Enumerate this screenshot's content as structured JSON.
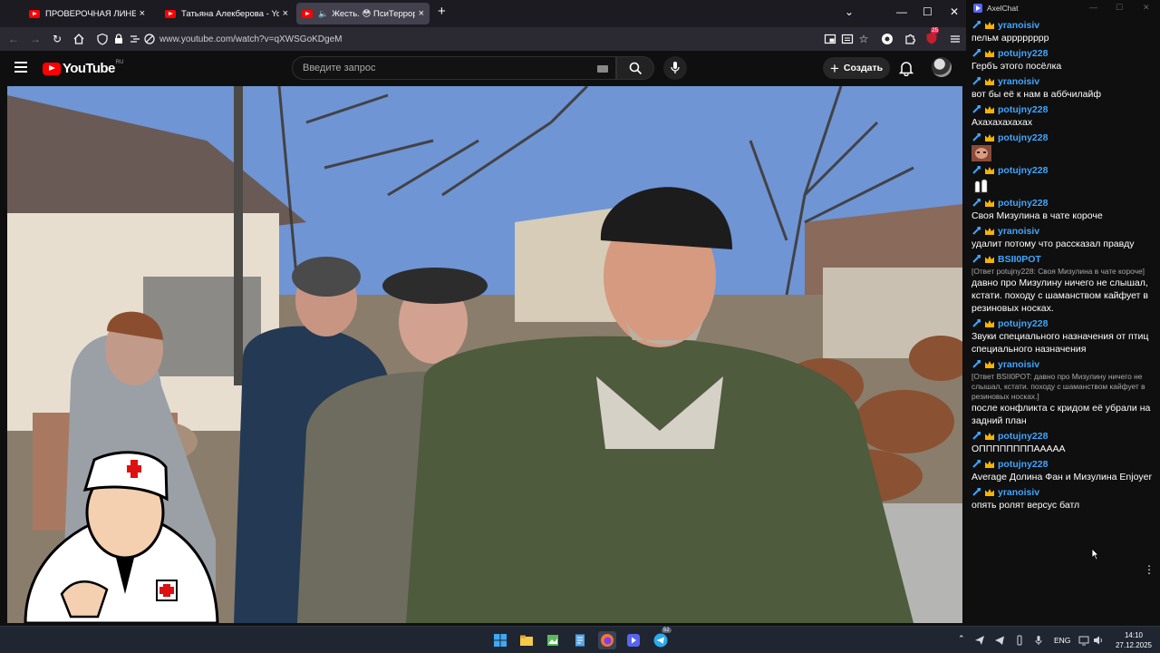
{
  "browser": {
    "tabs": [
      {
        "title": "ПРОВЕРОЧНАЯ ЛИНЕЙКА - M",
        "active": false,
        "playing": false
      },
      {
        "title": "Татьяна Алекберова - YouTube",
        "active": false,
        "playing": false
      },
      {
        "title": "Жесть. 😳 ПсиТеррор Сев",
        "active": true,
        "playing": true
      }
    ],
    "tab_close": "×",
    "new_tab": "+",
    "url": "www.youtube.com/watch?v=qXWSGoKDgeM",
    "extension_badge": "25",
    "window_controls": [
      "—",
      "☐",
      "✕"
    ],
    "tab_list": "⌄"
  },
  "youtube": {
    "logo_text": "YouTube",
    "logo_region": "RU",
    "search_placeholder": "Введите запрос",
    "create_label": "Создать",
    "create_plus": "+"
  },
  "chat": {
    "app_title": "AxelChat",
    "messages": [
      {
        "author": "yranoisiv",
        "reply": "",
        "text": "пельм арррррррр",
        "emote": ""
      },
      {
        "author": "potujny228",
        "reply": "",
        "text": "Гербъ этого посёлка",
        "emote": ""
      },
      {
        "author": "yranoisiv",
        "reply": "",
        "text": "вот бы её к нам в аббчилайф",
        "emote": ""
      },
      {
        "author": "potujny228",
        "reply": "",
        "text": "Ахахахахахах",
        "emote": ""
      },
      {
        "author": "potujny228",
        "reply": "",
        "text": "",
        "emote": "face-emote"
      },
      {
        "author": "potujny228",
        "reply": "",
        "text": "",
        "emote": "hands-emote"
      },
      {
        "author": "potujny228",
        "reply": "",
        "text": "Своя Мизулина в чате короче",
        "emote": ""
      },
      {
        "author": "yranoisiv",
        "reply": "",
        "text": "удалит потому что рассказал правду",
        "emote": ""
      },
      {
        "author": "BSII0POT",
        "reply": "[Ответ potujny228: Своя Мизулина в чате короче]",
        "text": "давно про Мизулину ничего не слышал, кстати. походу с шаманством кайфует в резиновых носках.",
        "emote": ""
      },
      {
        "author": "potujny228",
        "reply": "",
        "text": "Звуки специального назначения от птиц специального назначения",
        "emote": ""
      },
      {
        "author": "yranoisiv",
        "reply": "[Ответ BSII0POT: давно про Мизулину ничего не слышал, кстати. походу с шаманством кайфует в резиновых носках.]",
        "text": "после конфликта с кридом её убрали на задний план",
        "emote": ""
      },
      {
        "author": "potujny228",
        "reply": "",
        "text": "ОППППППППААААА",
        "emote": ""
      },
      {
        "author": "potujny228",
        "reply": "",
        "text": "Average Долина Фан и Мизулина Enjoyer",
        "emote": ""
      },
      {
        "author": "yranoisiv",
        "reply": "",
        "text": "опять ролят версус батл",
        "emote": ""
      }
    ],
    "more_menu": "⋮"
  },
  "taskbar": {
    "language": "ENG",
    "time": "14:10",
    "date": "27.12.2025",
    "telegram_badge": "52"
  },
  "colors": {
    "youtube_red": "#ff0000",
    "author_blue": "#3ea6ff",
    "crown_gold": "#f5b400",
    "taskbar_bg": "#1f2631"
  }
}
